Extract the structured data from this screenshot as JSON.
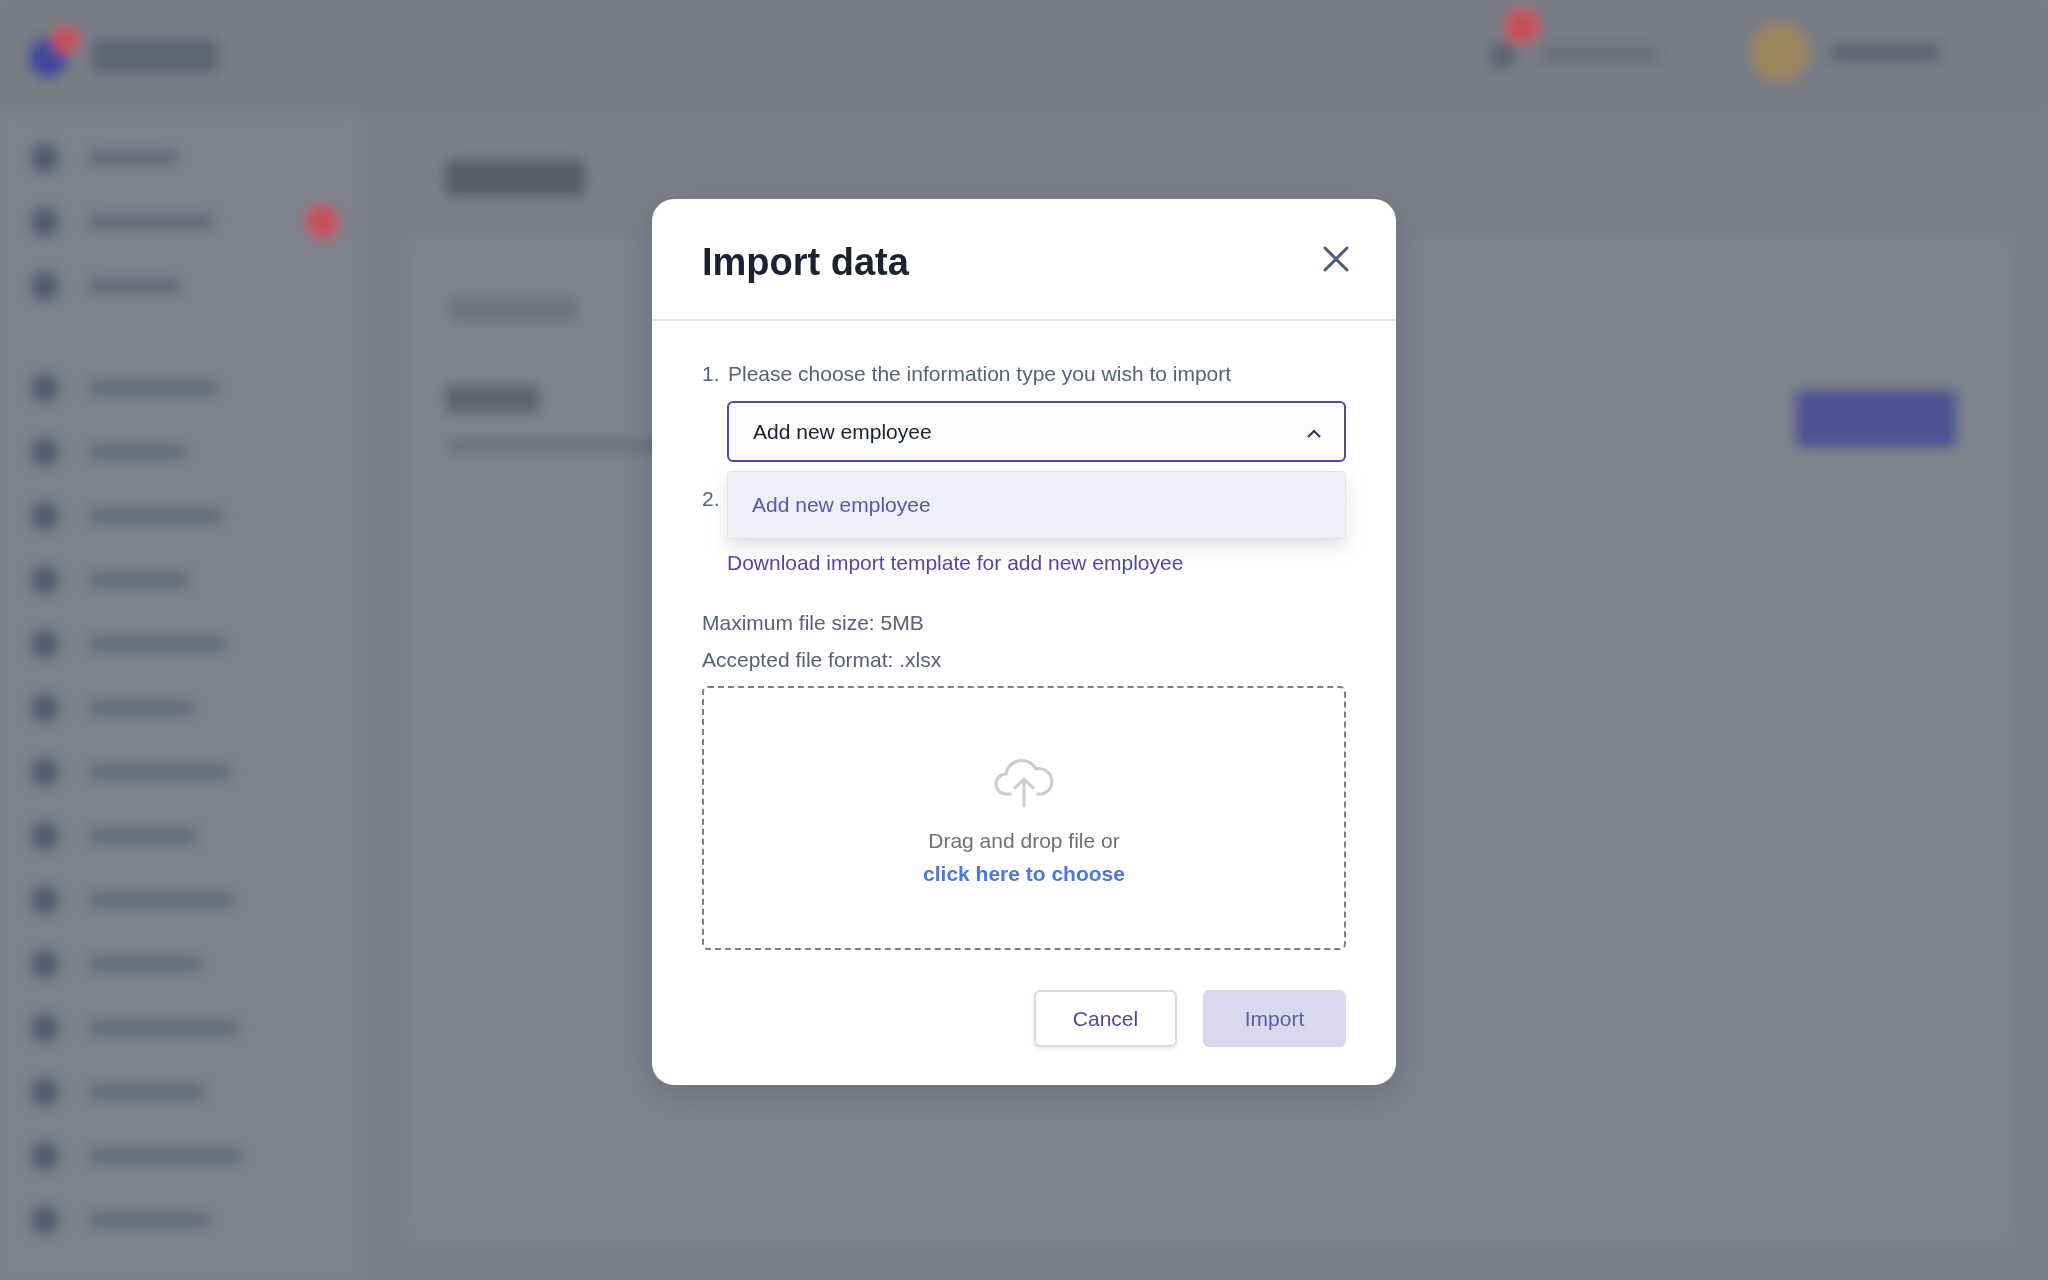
{
  "dialog": {
    "title": "Import data",
    "steps": [
      {
        "number": "1.",
        "text": "Please choose the information type you wish to import"
      },
      {
        "number": "2.",
        "link": "Download import template for add new employee"
      }
    ],
    "select": {
      "value": "Add new employee",
      "expanded": true
    },
    "options": [
      {
        "label": "Add new employee",
        "selected": true
      }
    ],
    "info": [
      "Maximum file size: 5MB",
      "Accepted file format: .xlsx"
    ],
    "dropzone": {
      "text": "Drag and drop file or",
      "link": "click here to choose"
    },
    "buttons": [
      {
        "label": "Cancel",
        "kind": "secondary",
        "disabled": false
      },
      {
        "label": "Import",
        "kind": "primary",
        "disabled": true
      }
    ]
  }
}
